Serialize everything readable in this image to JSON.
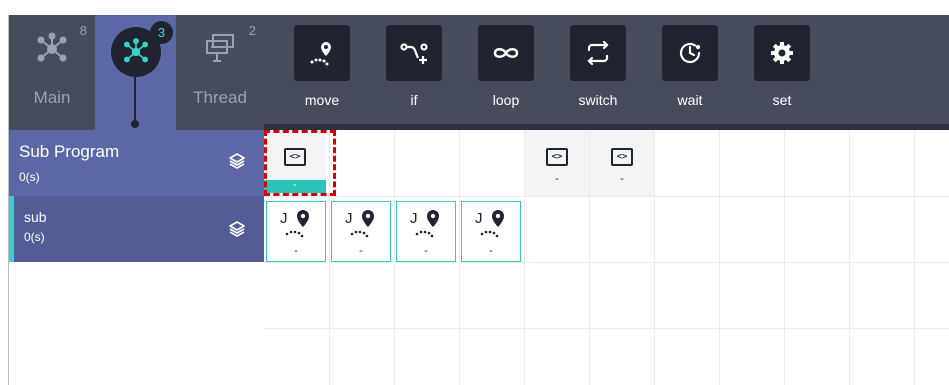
{
  "program_tabs": [
    {
      "label": "Main",
      "count": "8"
    },
    {
      "label": "",
      "count": "3"
    },
    {
      "label": "Thread",
      "count": "2"
    }
  ],
  "toolbar": {
    "tools": [
      {
        "label": "move",
        "icon": "move-pin-icon"
      },
      {
        "label": "if",
        "icon": "branch-add-icon"
      },
      {
        "label": "loop",
        "icon": "infinity-loop-icon"
      },
      {
        "label": "switch",
        "icon": "switch-arrows-icon"
      },
      {
        "label": "wait",
        "icon": "clock-timer-icon"
      },
      {
        "label": "set",
        "icon": "gear-icon"
      }
    ]
  },
  "sub_program": {
    "title": "Sub Program",
    "count": "0(s)"
  },
  "sub_list": [
    {
      "name": "sub",
      "count": "0(s)"
    }
  ],
  "timeline": {
    "node_commands": [
      {
        "icon_text": "<>",
        "value": "-"
      },
      {
        "icon_text": "<>",
        "value": "-"
      },
      {
        "icon_text": "<>",
        "value": "-"
      }
    ],
    "joint_moves": [
      {
        "letter": "J",
        "value": "-"
      },
      {
        "letter": "J",
        "value": "-"
      },
      {
        "letter": "J",
        "value": "-"
      },
      {
        "letter": "J",
        "value": "-"
      }
    ]
  },
  "colors": {
    "panel_dark": "#464c5c",
    "sub_blue": "#5c67a6",
    "accent_teal": "#2bc4b8",
    "selection_red": "#d40000"
  }
}
